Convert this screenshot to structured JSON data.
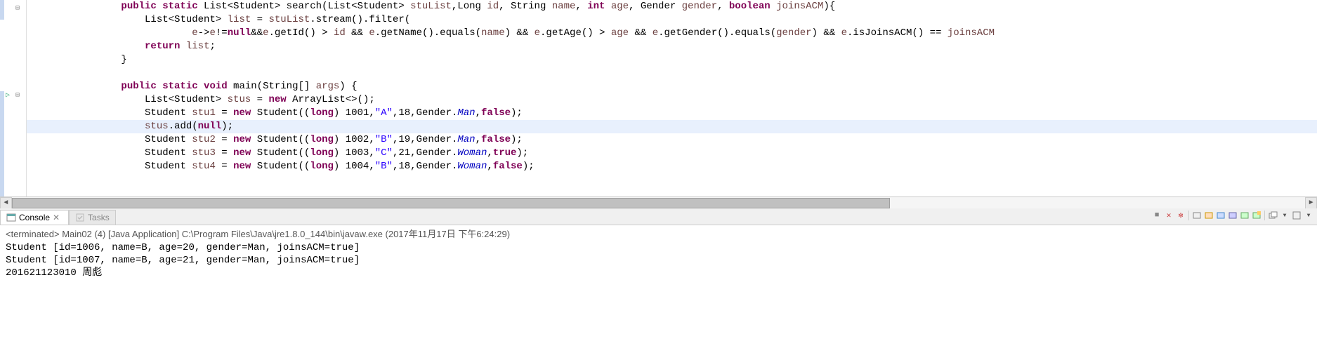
{
  "code": {
    "lines": [
      {
        "indent": 2,
        "segments": [
          {
            "cls": "kw",
            "text": "public static"
          },
          {
            "cls": "",
            "text": " List<Student> search(List<Student> "
          },
          {
            "cls": "param",
            "text": "stuList"
          },
          {
            "cls": "",
            "text": ",Long "
          },
          {
            "cls": "param",
            "text": "id"
          },
          {
            "cls": "",
            "text": ", String "
          },
          {
            "cls": "param",
            "text": "name"
          },
          {
            "cls": "",
            "text": ", "
          },
          {
            "cls": "kw",
            "text": "int"
          },
          {
            "cls": "",
            "text": " "
          },
          {
            "cls": "param",
            "text": "age"
          },
          {
            "cls": "",
            "text": ", Gender "
          },
          {
            "cls": "param",
            "text": "gender"
          },
          {
            "cls": "",
            "text": ", "
          },
          {
            "cls": "kw",
            "text": "boolean"
          },
          {
            "cls": "",
            "text": " "
          },
          {
            "cls": "param",
            "text": "joinsACM"
          },
          {
            "cls": "",
            "text": "){"
          }
        ]
      },
      {
        "indent": 3,
        "segments": [
          {
            "cls": "",
            "text": "List<Student> "
          },
          {
            "cls": "param",
            "text": "list"
          },
          {
            "cls": "",
            "text": " = "
          },
          {
            "cls": "param",
            "text": "stuList"
          },
          {
            "cls": "",
            "text": ".stream().filter("
          }
        ]
      },
      {
        "indent": 5,
        "segments": [
          {
            "cls": "param",
            "text": "e"
          },
          {
            "cls": "",
            "text": "->"
          },
          {
            "cls": "param",
            "text": "e"
          },
          {
            "cls": "",
            "text": "!="
          },
          {
            "cls": "kw",
            "text": "null"
          },
          {
            "cls": "",
            "text": "&&"
          },
          {
            "cls": "param",
            "text": "e"
          },
          {
            "cls": "",
            "text": ".getId() > "
          },
          {
            "cls": "param",
            "text": "id"
          },
          {
            "cls": "",
            "text": " && "
          },
          {
            "cls": "param",
            "text": "e"
          },
          {
            "cls": "",
            "text": ".getName().equals("
          },
          {
            "cls": "param",
            "text": "name"
          },
          {
            "cls": "",
            "text": ") && "
          },
          {
            "cls": "param",
            "text": "e"
          },
          {
            "cls": "",
            "text": ".getAge() > "
          },
          {
            "cls": "param",
            "text": "age"
          },
          {
            "cls": "",
            "text": " && "
          },
          {
            "cls": "param",
            "text": "e"
          },
          {
            "cls": "",
            "text": ".getGender().equals("
          },
          {
            "cls": "param",
            "text": "gender"
          },
          {
            "cls": "",
            "text": ") && "
          },
          {
            "cls": "param",
            "text": "e"
          },
          {
            "cls": "",
            "text": ".isJoinsACM() == "
          },
          {
            "cls": "param",
            "text": "joinsACM"
          }
        ]
      },
      {
        "indent": 3,
        "segments": [
          {
            "cls": "kw",
            "text": "return"
          },
          {
            "cls": "",
            "text": " "
          },
          {
            "cls": "param",
            "text": "list"
          },
          {
            "cls": "",
            "text": ";"
          }
        ]
      },
      {
        "indent": 2,
        "segments": [
          {
            "cls": "",
            "text": "}"
          }
        ]
      },
      {
        "indent": 2,
        "segments": [
          {
            "cls": "",
            "text": ""
          }
        ]
      },
      {
        "indent": 2,
        "segments": [
          {
            "cls": "kw",
            "text": "public static void"
          },
          {
            "cls": "",
            "text": " main(String[] "
          },
          {
            "cls": "param",
            "text": "args"
          },
          {
            "cls": "",
            "text": ") {"
          }
        ]
      },
      {
        "indent": 3,
        "segments": [
          {
            "cls": "",
            "text": "List<Student> "
          },
          {
            "cls": "param",
            "text": "stus"
          },
          {
            "cls": "",
            "text": " = "
          },
          {
            "cls": "kw",
            "text": "new"
          },
          {
            "cls": "",
            "text": " ArrayList<>();"
          }
        ]
      },
      {
        "indent": 3,
        "segments": [
          {
            "cls": "",
            "text": "Student "
          },
          {
            "cls": "param",
            "text": "stu1"
          },
          {
            "cls": "",
            "text": " = "
          },
          {
            "cls": "kw",
            "text": "new"
          },
          {
            "cls": "",
            "text": " Student(("
          },
          {
            "cls": "kw",
            "text": "long"
          },
          {
            "cls": "",
            "text": ") 1001,"
          },
          {
            "cls": "str",
            "text": "\"A\""
          },
          {
            "cls": "",
            "text": ",18,Gender."
          },
          {
            "cls": "em",
            "text": "Man"
          },
          {
            "cls": "",
            "text": ","
          },
          {
            "cls": "kw",
            "text": "false"
          },
          {
            "cls": "",
            "text": ");"
          }
        ]
      },
      {
        "indent": 3,
        "highlight": true,
        "segments": [
          {
            "cls": "param",
            "text": "stus"
          },
          {
            "cls": "",
            "text": ".add("
          },
          {
            "cls": "kw",
            "text": "null"
          },
          {
            "cls": "",
            "text": ");"
          }
        ]
      },
      {
        "indent": 3,
        "segments": [
          {
            "cls": "",
            "text": "Student "
          },
          {
            "cls": "param",
            "text": "stu2"
          },
          {
            "cls": "",
            "text": " = "
          },
          {
            "cls": "kw",
            "text": "new"
          },
          {
            "cls": "",
            "text": " Student(("
          },
          {
            "cls": "kw",
            "text": "long"
          },
          {
            "cls": "",
            "text": ") 1002,"
          },
          {
            "cls": "str",
            "text": "\"B\""
          },
          {
            "cls": "",
            "text": ",19,Gender."
          },
          {
            "cls": "em",
            "text": "Man"
          },
          {
            "cls": "",
            "text": ","
          },
          {
            "cls": "kw",
            "text": "false"
          },
          {
            "cls": "",
            "text": ");"
          }
        ]
      },
      {
        "indent": 3,
        "segments": [
          {
            "cls": "",
            "text": "Student "
          },
          {
            "cls": "param",
            "text": "stu3"
          },
          {
            "cls": "",
            "text": " = "
          },
          {
            "cls": "kw",
            "text": "new"
          },
          {
            "cls": "",
            "text": " Student(("
          },
          {
            "cls": "kw",
            "text": "long"
          },
          {
            "cls": "",
            "text": ") 1003,"
          },
          {
            "cls": "str",
            "text": "\"C\""
          },
          {
            "cls": "",
            "text": ",21,Gender."
          },
          {
            "cls": "em",
            "text": "Woman"
          },
          {
            "cls": "",
            "text": ","
          },
          {
            "cls": "kw",
            "text": "true"
          },
          {
            "cls": "",
            "text": ");"
          }
        ]
      },
      {
        "indent": 3,
        "segments": [
          {
            "cls": "",
            "text": "Student "
          },
          {
            "cls": "param",
            "text": "stu4"
          },
          {
            "cls": "",
            "text": " = "
          },
          {
            "cls": "kw",
            "text": "new"
          },
          {
            "cls": "",
            "text": " Student(("
          },
          {
            "cls": "kw",
            "text": "long"
          },
          {
            "cls": "",
            "text": ") 1004,"
          },
          {
            "cls": "str",
            "text": "\"B\""
          },
          {
            "cls": "",
            "text": ",18,Gender."
          },
          {
            "cls": "em",
            "text": "Woman"
          },
          {
            "cls": "",
            "text": ","
          },
          {
            "cls": "kw",
            "text": "false"
          },
          {
            "cls": "",
            "text": ");"
          }
        ]
      }
    ]
  },
  "tabs": {
    "console": "Console",
    "tasks": "Tasks"
  },
  "console": {
    "status_prefix": "<terminated> ",
    "status": "Main02 (4) [Java Application] C:\\Program Files\\Java\\jre1.8.0_144\\bin\\javaw.exe (2017年11月17日 下午6:24:29)",
    "output": "Student [id=1006, name=B, age=20, gender=Man, joinsACM=true]\nStudent [id=1007, name=B, age=21, gender=Man, joinsACM=true]\n201621123010 周彪"
  },
  "toolbar": {
    "icons": [
      "■",
      "✕",
      "✻",
      "|",
      "⬚",
      "⬚",
      "⬚",
      "⬚",
      "⬚",
      "⬚",
      "|",
      "◱",
      "▾",
      "◫",
      "▾"
    ]
  }
}
